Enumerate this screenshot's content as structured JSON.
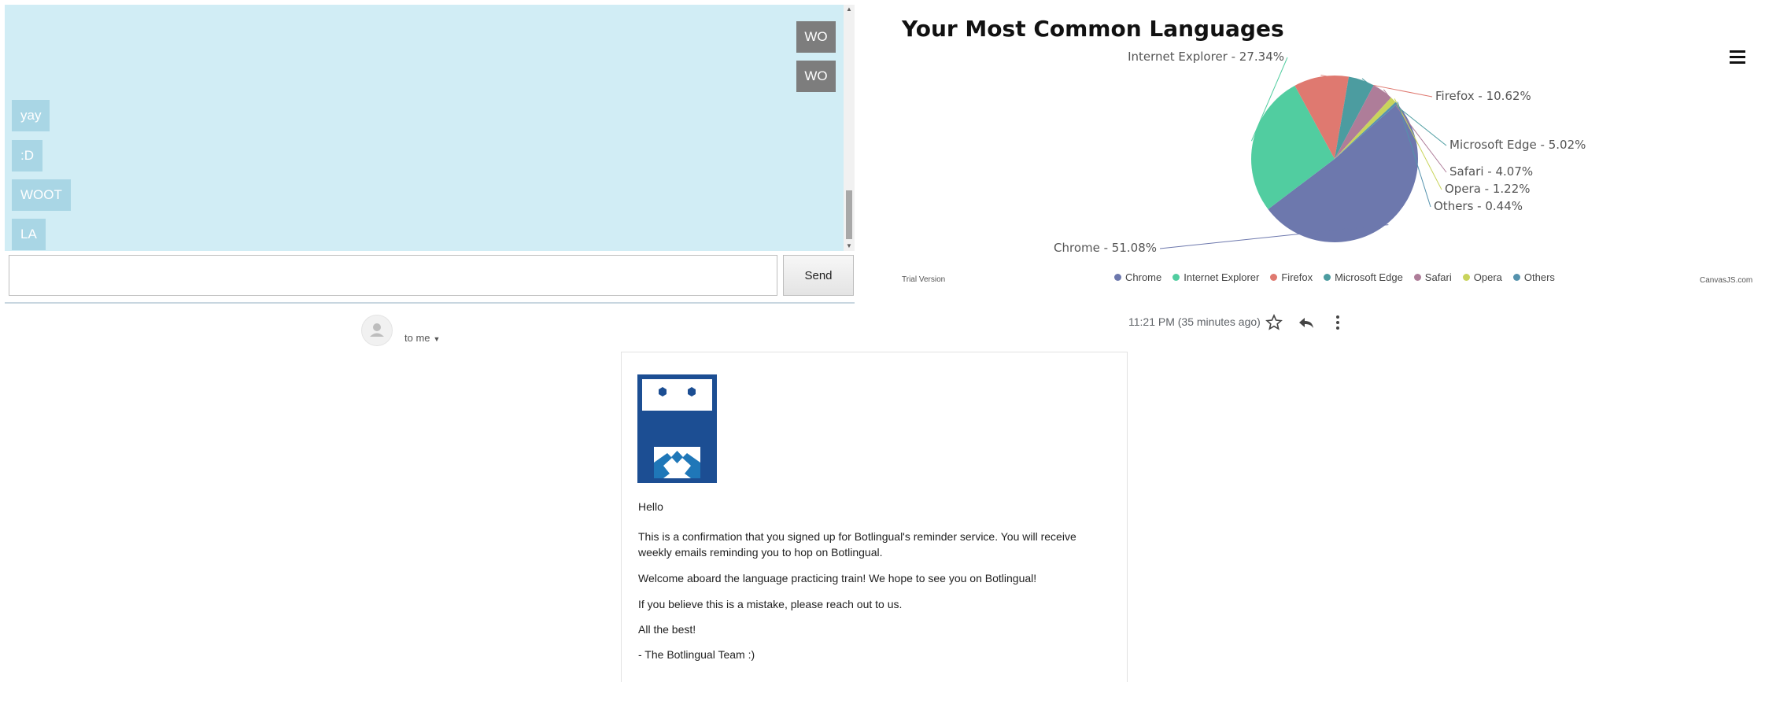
{
  "chat": {
    "other_messages": [
      "yay",
      ":D",
      "WOOT",
      "LA"
    ],
    "self_messages": [
      "",
      "WO",
      "WO"
    ],
    "input_value": "",
    "send_label": "Send",
    "colors": {
      "background": "#d1edf5",
      "other_bubble": "#a9d6e5",
      "self_bubble": "#7d7d7d"
    }
  },
  "chart": {
    "title": "Your Most Common Languages",
    "trial_label": "Trial Version",
    "credit_label": "CanvasJS.com"
  },
  "chart_data": {
    "type": "pie",
    "title": "Your Most Common Languages",
    "labels": [
      "Chrome",
      "Internet Explorer",
      "Firefox",
      "Microsoft Edge",
      "Safari",
      "Opera",
      "Others"
    ],
    "values": [
      51.08,
      27.34,
      10.62,
      5.02,
      4.07,
      1.22,
      0.44
    ],
    "slice_labels": [
      "Chrome - 51.08%",
      "Internet Explorer - 27.34%",
      "Firefox - 10.62%",
      "Microsoft Edge - 5.02%",
      "Safari - 4.07%",
      "Opera - 1.22%",
      "Others - 0.44%"
    ],
    "colors": [
      "#6d78ad",
      "#51cda0",
      "#df7970",
      "#4c9ca0",
      "#ae7d99",
      "#c9d45c",
      "#5592ad"
    ],
    "legend_placement": "bottom"
  },
  "email": {
    "to_me": "to me",
    "timestamp": "11:21 PM (35 minutes ago)",
    "greeting": "Hello",
    "paragraphs": [
      "This is a confirmation that you signed up for Botlingual's reminder service. You will receive weekly emails reminding you to hop on Botlingual.",
      "Welcome aboard the language practicing train! We hope to see you on Botlingual!",
      "If you believe this is a mistake, please reach out to us.",
      "All the best!",
      "- The Botlingual Team :)"
    ],
    "icons": [
      "person-icon",
      "star-icon",
      "reply-icon",
      "more-vert-icon"
    ]
  }
}
